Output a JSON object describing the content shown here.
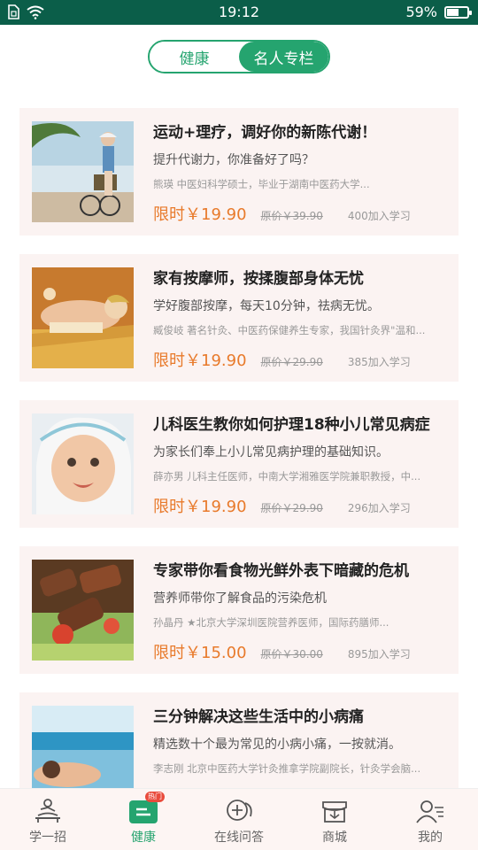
{
  "status_bar": {
    "time": "19:12",
    "battery": "59%",
    "battery_level": 0.59
  },
  "tabs": [
    {
      "label": "健康",
      "active": false
    },
    {
      "label": "名人专栏",
      "active": true
    }
  ],
  "courses": [
    {
      "title": "运动+理疗，调好你的新陈代谢！",
      "subtitle": "提升代谢力，你准备好了吗？",
      "author": "熊瑛 中医妇科学硕士，毕业于湖南中医药大学...",
      "price": "限时￥19.90",
      "original_price": "原价￥39.90",
      "learners": "400加入学习"
    },
    {
      "title": "家有按摩师，按揉腹部身体无忧",
      "subtitle": "学好腹部按摩，每天10分钟，祛病无忧。",
      "author": "臧俊岐 著名针灸、中医药保健养生专家，我国针灸界\"温和...",
      "price": "限时￥19.90",
      "original_price": "原价￥29.90",
      "learners": "385加入学习"
    },
    {
      "title": "儿科医生教你如何护理18种小儿常见病症",
      "subtitle": "为家长们奉上小儿常见病护理的基础知识。",
      "author": "薛亦男 儿科主任医师，中南大学湘雅医学院兼职教授，中...",
      "price": "限时￥19.90",
      "original_price": "原价￥29.90",
      "learners": "296加入学习"
    },
    {
      "title": "专家带你看食物光鲜外表下暗藏的危机",
      "subtitle": "营养师带你了解食品的污染危机",
      "author": "孙晶丹 ★北京大学深圳医院营养医师，国际药膳师...",
      "price": "限时￥15.00",
      "original_price": "原价￥30.00",
      "learners": "895加入学习"
    },
    {
      "title": "三分钟解决这些生活中的小病痛",
      "subtitle": "精选数十个最为常见的小病小痛，一按就消。",
      "author": "李志刚 北京中医药大学针灸推拿学院副院长，针灸学会脑...",
      "price": "",
      "original_price": "",
      "learners": ""
    }
  ],
  "bottom_nav": [
    {
      "label": "学一招",
      "icon": "massage-person-icon",
      "active": false
    },
    {
      "label": "健康",
      "icon": "health-tag-icon",
      "active": true,
      "badge": "热门"
    },
    {
      "label": "在线问答",
      "icon": "chat-question-icon",
      "active": false
    },
    {
      "label": "商城",
      "icon": "shop-icon",
      "active": false
    },
    {
      "label": "我的",
      "icon": "profile-icon",
      "active": false
    }
  ],
  "colors": {
    "accent": "#25a46f",
    "status_bar": "#0b5e49",
    "price": "#e87a2b",
    "card_bg": "#fbf3f2"
  }
}
